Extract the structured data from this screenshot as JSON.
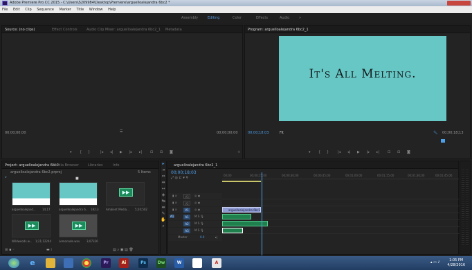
{
  "titlebar": {
    "title": "Adobe Premiere Pro CC 2015 - C:\\Users\\S209984\\Desktop\\Premiere\\arguelloalejandra 6bc2 *"
  },
  "menu": [
    "File",
    "Edit",
    "Clip",
    "Sequence",
    "Marker",
    "Title",
    "Window",
    "Help"
  ],
  "workspaces": [
    "Assembly",
    "Editing",
    "Color",
    "Effects",
    "Audio",
    "»"
  ],
  "source_panel": {
    "tabs": [
      "Source: (no clips)",
      "Effect Controls",
      "Audio Clip Mixer: arguelloalejandra 6bc2_1",
      "Metadata"
    ],
    "timecode_left": "00;00;00;00",
    "timecode_right": "00;00;00;00"
  },
  "program_panel": {
    "tab": "Program: arguelloalejandra 6bc2_1",
    "frame_text": "It's All Melting.",
    "timecode": "00;00;18;03",
    "duration": "00;00;18;13",
    "fit_label": "Fit"
  },
  "project_panel": {
    "tabs": [
      "Project: arguelloalejandra 6bc2",
      "Media Browser",
      "Libraries",
      "Info"
    ],
    "path": "arguelloalejandra 6bc2.prproj",
    "item_count": "5 Items",
    "items": [
      {
        "label": "arguelloalejand...",
        "meta": "14;17",
        "kind": "video"
      },
      {
        "label": "arguelloalejandra 6...",
        "meta": "18;13",
        "kind": "video"
      },
      {
        "label": "Ambient Media...",
        "meta": "5;20;502",
        "kind": "audio"
      },
      {
        "label": "Wildwoods.w...",
        "meta": "1;21;12244",
        "kind": "audio"
      },
      {
        "label": "Lemonade.wav",
        "meta": "3;07326",
        "kind": "audio"
      }
    ]
  },
  "timeline": {
    "tab": "arguelloalejandra 6bc2_1",
    "timecode": "00;00;18;03",
    "ruler": [
      "00;00",
      "00;00;15;00",
      "00;00;30;00",
      "00;00;45;00",
      "00;01;00;00",
      "00;01;15;00",
      "00;01;30;00",
      "00;01;45;00"
    ],
    "tracks": [
      {
        "name": "V3",
        "kind": "video"
      },
      {
        "name": "V2",
        "kind": "video"
      },
      {
        "name": "V1",
        "kind": "video"
      },
      {
        "name": "A1",
        "kind": "audio"
      },
      {
        "name": "A2",
        "kind": "audio"
      },
      {
        "name": "A3",
        "kind": "audio"
      }
    ],
    "master_label": "Master",
    "master_value": "0.0",
    "clip_label": "arguelloalejandra 6bc2"
  },
  "taskbar": {
    "time": "1:05 PM",
    "date": "4/28/2016"
  }
}
